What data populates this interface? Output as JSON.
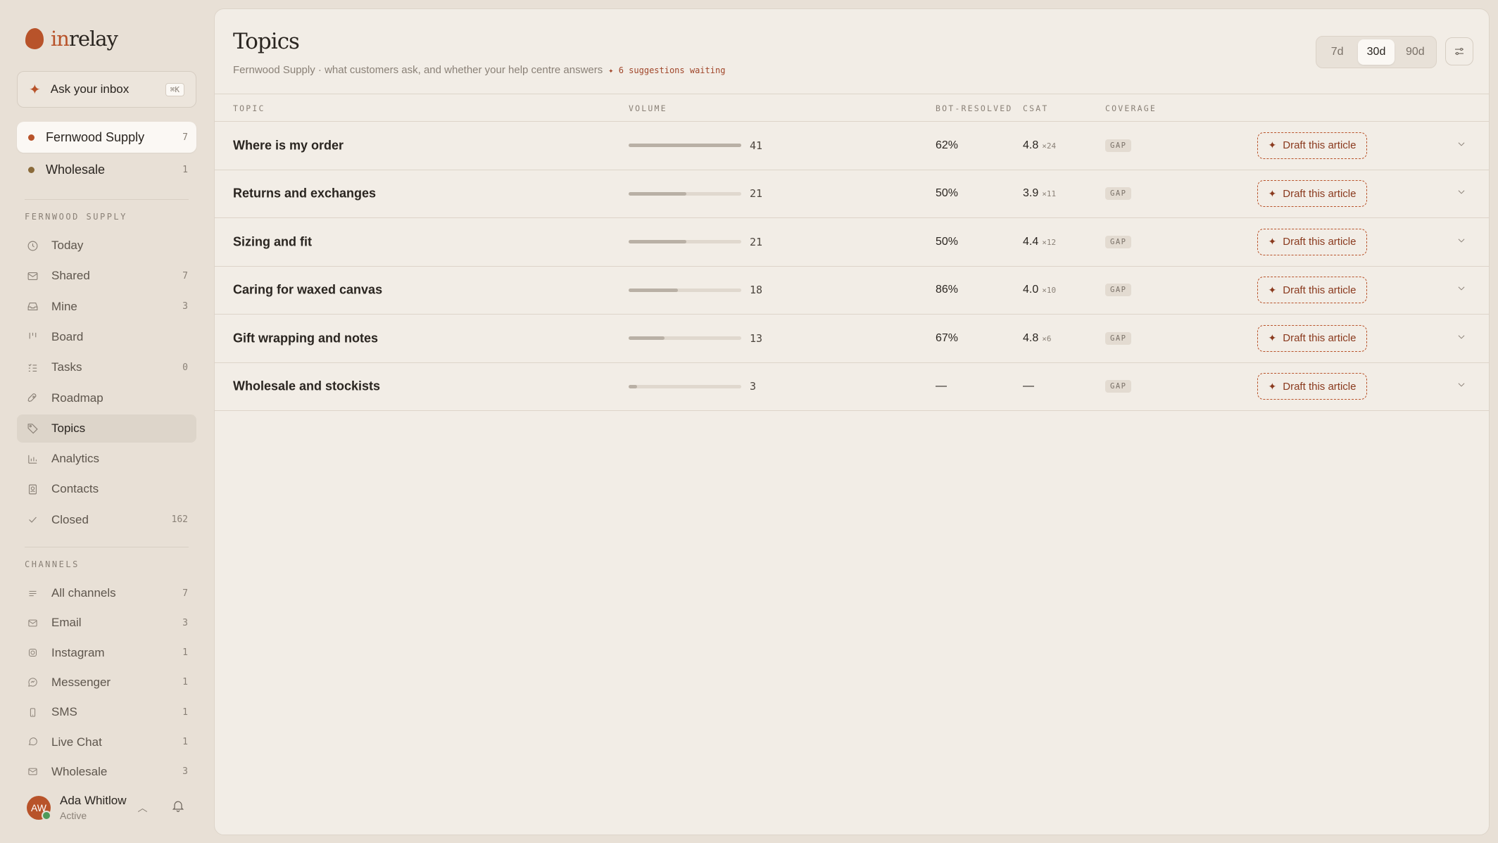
{
  "app": {
    "brand_prefix": "in",
    "brand_suffix": "relay"
  },
  "ask": {
    "label": "Ask your inbox",
    "shortcut": "⌘K"
  },
  "workspaces": [
    {
      "label": "Fernwood Supply",
      "count": "7",
      "dot_color": "#b8532a",
      "active": true
    },
    {
      "label": "Wholesale",
      "count": "1",
      "dot_color": "#8a6a3a",
      "active": false
    }
  ],
  "nav": {
    "section_label": "FERNWOOD SUPPLY",
    "items": [
      {
        "label": "Today",
        "count": "",
        "icon": "clock-icon"
      },
      {
        "label": "Shared",
        "count": "7",
        "icon": "inbox-icon"
      },
      {
        "label": "Mine",
        "count": "3",
        "icon": "tray-icon"
      },
      {
        "label": "Board",
        "count": "",
        "icon": "board-icon"
      },
      {
        "label": "Tasks",
        "count": "0",
        "icon": "tasks-icon"
      },
      {
        "label": "Roadmap",
        "count": "",
        "icon": "rocket-icon"
      },
      {
        "label": "Topics",
        "count": "",
        "icon": "tag-icon"
      },
      {
        "label": "Analytics",
        "count": "",
        "icon": "chart-icon"
      },
      {
        "label": "Contacts",
        "count": "",
        "icon": "contact-icon"
      },
      {
        "label": "Closed",
        "count": "162",
        "icon": "check-icon"
      }
    ]
  },
  "channels": {
    "section_label": "CHANNELS",
    "items": [
      {
        "label": "All channels",
        "count": "7",
        "icon": "list-icon"
      },
      {
        "label": "Email",
        "count": "3",
        "icon": "mail-icon"
      },
      {
        "label": "Instagram",
        "count": "1",
        "icon": "instagram-icon"
      },
      {
        "label": "Messenger",
        "count": "1",
        "icon": "messenger-icon"
      },
      {
        "label": "SMS",
        "count": "1",
        "icon": "phone-icon"
      },
      {
        "label": "Live Chat",
        "count": "1",
        "icon": "chat-icon"
      },
      {
        "label": "Wholesale",
        "count": "3",
        "icon": "mail-icon"
      }
    ]
  },
  "user": {
    "initials": "AW",
    "name": "Ada Whitlow",
    "status": "Active"
  },
  "page": {
    "title": "Topics",
    "subtitle": "Fernwood Supply · what customers ask, and whether your help centre answers",
    "suggestions": "✦ 6 suggestions waiting"
  },
  "ranges": [
    {
      "label": "7d",
      "active": false
    },
    {
      "label": "30d",
      "active": true
    },
    {
      "label": "90d",
      "active": false
    }
  ],
  "table": {
    "headers": {
      "topic": "TOPIC",
      "volume": "VOLUME",
      "bot": "BOT-RESOLVED",
      "csat": "CSAT",
      "coverage": "COVERAGE"
    },
    "max_volume": 41,
    "rows": [
      {
        "topic": "Where is my order",
        "volume": 41,
        "bot": "62%",
        "csat": "4.8",
        "csat_n": "×24",
        "coverage": "GAP",
        "action": "Draft this article"
      },
      {
        "topic": "Returns and exchanges",
        "volume": 21,
        "bot": "50%",
        "csat": "3.9",
        "csat_n": "×11",
        "coverage": "GAP",
        "action": "Draft this article"
      },
      {
        "topic": "Sizing and fit",
        "volume": 21,
        "bot": "50%",
        "csat": "4.4",
        "csat_n": "×12",
        "coverage": "GAP",
        "action": "Draft this article"
      },
      {
        "topic": "Caring for waxed canvas",
        "volume": 18,
        "bot": "86%",
        "csat": "4.0",
        "csat_n": "×10",
        "coverage": "GAP",
        "action": "Draft this article"
      },
      {
        "topic": "Gift wrapping and notes",
        "volume": 13,
        "bot": "67%",
        "csat": "4.8",
        "csat_n": "×6",
        "coverage": "GAP",
        "action": "Draft this article"
      },
      {
        "topic": "Wholesale and stockists",
        "volume": 3,
        "bot": "—",
        "csat": "—",
        "csat_n": "",
        "coverage": "GAP",
        "action": "Draft this article"
      }
    ]
  }
}
